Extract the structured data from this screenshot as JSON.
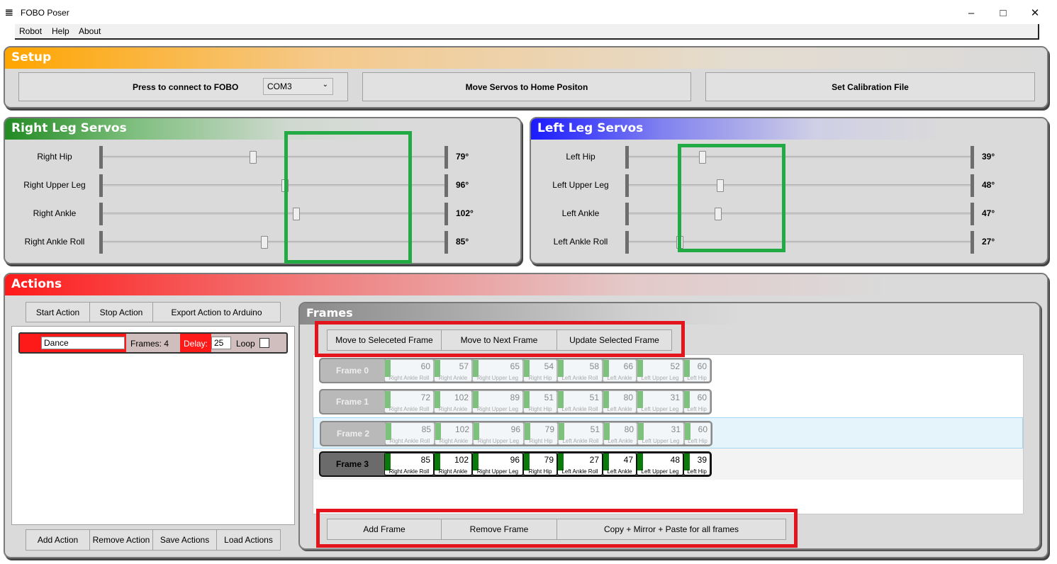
{
  "window": {
    "title": "FOBO Poser",
    "icon": "feet-icon"
  },
  "menu": [
    "Robot",
    "Help",
    "About"
  ],
  "setup": {
    "title": "Setup",
    "connect_label": "Press to connect to FOBO",
    "port_value": "COM3",
    "home_label": "Move Servos to Home Positon",
    "calibration_label": "Set Calibration File"
  },
  "right_leg": {
    "title": "Right Leg Servos",
    "servos": [
      {
        "label": "Right Hip",
        "value": "79°",
        "angle": 79
      },
      {
        "label": "Right Upper Leg",
        "value": "96°",
        "angle": 96
      },
      {
        "label": "Right Ankle",
        "value": "102°",
        "angle": 102
      },
      {
        "label": "Right Ankle Roll",
        "value": "85°",
        "angle": 85
      }
    ]
  },
  "left_leg": {
    "title": "Left Leg Servos",
    "servos": [
      {
        "label": "Left Hip",
        "value": "39°",
        "angle": 39
      },
      {
        "label": "Left Upper Leg",
        "value": "48°",
        "angle": 48
      },
      {
        "label": "Left Ankle",
        "value": "47°",
        "angle": 47
      },
      {
        "label": "Left Ankle Roll",
        "value": "27°",
        "angle": 27
      }
    ]
  },
  "actions": {
    "title": "Actions",
    "start_label": "Start Action",
    "stop_label": "Stop Action",
    "export_label": "Export Action to Arduino",
    "item": {
      "name": "Dance",
      "frames_label": "Frames: 4",
      "delay_label": "Delay:",
      "delay_value": "25",
      "loop_label": "Loop"
    },
    "add_label": "Add Action",
    "remove_label": "Remove Action",
    "save_label": "Save Actions",
    "load_label": "Load Actions"
  },
  "frames": {
    "title": "Frames",
    "move_selected_label": "Move to Seleceted Frame",
    "move_next_label": "Move to Next Frame",
    "update_label": "Update Selected Frame",
    "add_label": "Add Frame",
    "remove_label": "Remove Frame",
    "copy_label": "Copy + Mirror + Paste for all frames",
    "servo_names": [
      "Right Ankle Roll",
      "Right Ankle",
      "Right Upper Leg",
      "Right Hip",
      "Left Ankle Roll",
      "Left Ankle",
      "Left Upper Leg",
      "Left Hip"
    ],
    "rows": [
      {
        "label": "Frame 0",
        "values": [
          "60",
          "57",
          "65",
          "54",
          "58",
          "66",
          "52",
          "60"
        ]
      },
      {
        "label": "Frame 1",
        "values": [
          "72",
          "102",
          "89",
          "51",
          "51",
          "80",
          "31",
          "60"
        ]
      },
      {
        "label": "Frame 2",
        "values": [
          "85",
          "102",
          "96",
          "79",
          "51",
          "80",
          "31",
          "60"
        ]
      },
      {
        "label": "Frame 3",
        "values": [
          "85",
          "102",
          "96",
          "79",
          "27",
          "47",
          "48",
          "39"
        ]
      }
    ]
  }
}
